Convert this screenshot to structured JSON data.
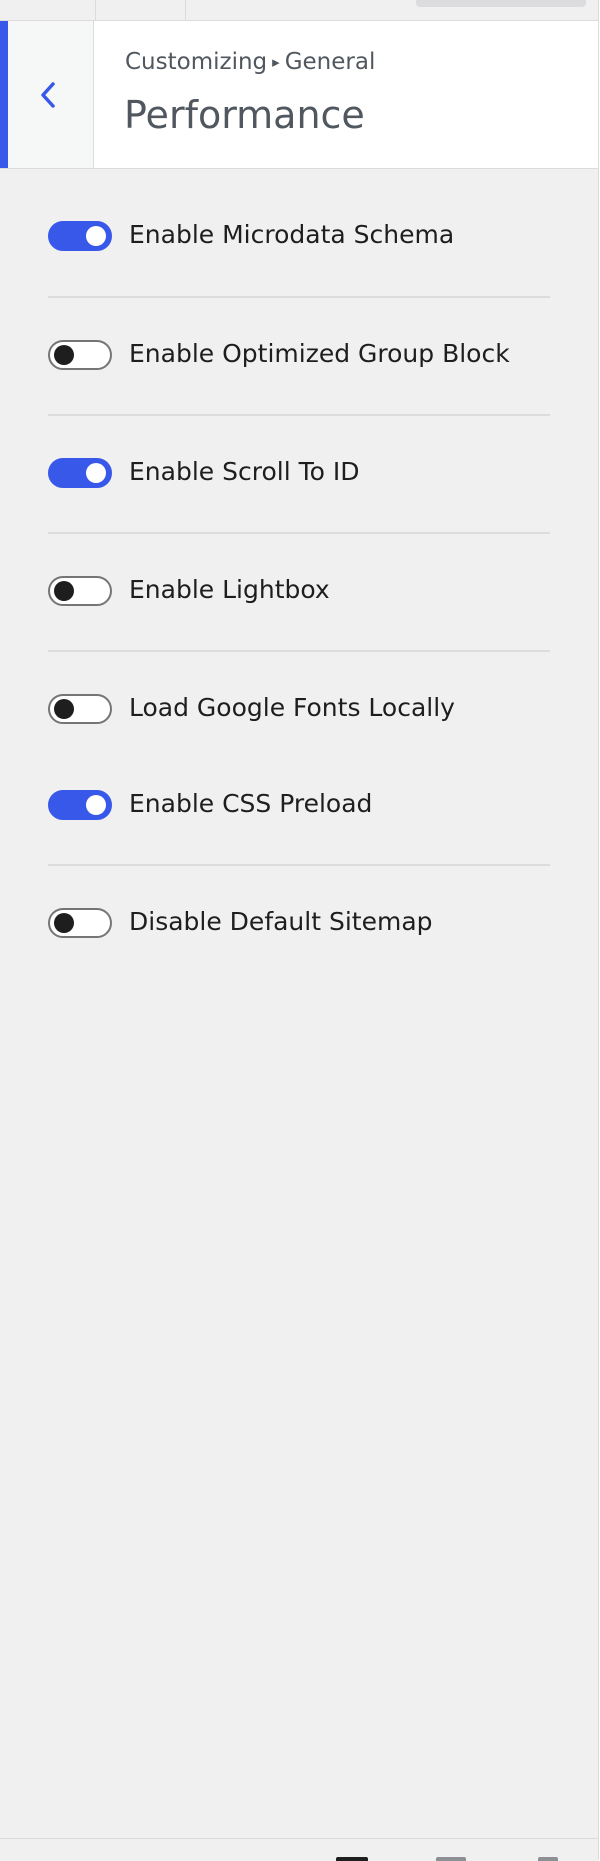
{
  "header": {
    "breadcrumb_prefix": "Customizing",
    "breadcrumb_arrow": "▸",
    "breadcrumb_section": "General",
    "title": "Performance",
    "back_icon": "chevron-left-icon"
  },
  "options": [
    {
      "label": "Enable Microdata Schema",
      "enabled": true
    },
    {
      "label": "Enable Optimized Group Block",
      "enabled": false
    },
    {
      "label": "Enable Scroll To ID",
      "enabled": true
    },
    {
      "label": "Enable Lightbox",
      "enabled": false
    },
    {
      "label": "Load Google Fonts Locally",
      "enabled": false
    },
    {
      "label": "Enable CSS Preload",
      "enabled": true
    },
    {
      "label": "Disable Default Sitemap",
      "enabled": false
    }
  ],
  "colors": {
    "accent": "#3858e9",
    "panel_bg": "#f0f0f1",
    "text": "#1e1e1e",
    "muted_text": "#50575e"
  },
  "footer": {
    "device_icons": [
      "desktop-icon",
      "tablet-icon",
      "mobile-icon"
    ]
  }
}
